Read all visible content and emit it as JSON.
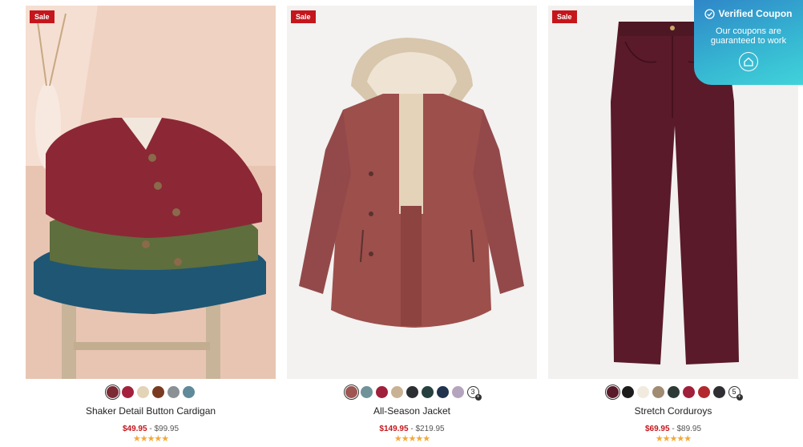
{
  "products": [
    {
      "badge": "Sale",
      "name": "Shaker Detail Button Cardigan",
      "sale_price": "$49.95",
      "separator": "-",
      "original_price": "$99.95",
      "rating_stars": "★★★★★",
      "image_icon": "stacked-cardigans-image",
      "swatches": [
        "#7c2a34",
        "#a3213d",
        "#e3d3b7",
        "#7a3a22",
        "#8a9094",
        "#5e8a9a"
      ],
      "selected_swatch": 0
    },
    {
      "badge": "Sale",
      "name": "All-Season Jacket",
      "sale_price": "$149.95",
      "separator": "-",
      "original_price": "$219.95",
      "rating_stars": "★★★★★",
      "image_icon": "hooded-jacket-image",
      "swatches": [
        "#9e5652",
        "#6f9398",
        "#a01f3b",
        "#c9b294",
        "#2b2e33",
        "#26403f",
        "#21324e",
        "#b5a4bd"
      ],
      "selected_swatch": 0,
      "more_count": "3"
    },
    {
      "badge": "Sale",
      "name": "Stretch Corduroys",
      "sale_price": "$69.95",
      "separator": "-",
      "original_price": "$89.95",
      "rating_stars": "★★★★★",
      "image_icon": "corduroy-pants-image",
      "swatches": [
        "#5a1a2a",
        "#1c1c1c",
        "#f1eadf",
        "#a08b73",
        "#2d3a36",
        "#a01f3b",
        "#b3282f",
        "#2f2f33"
      ],
      "selected_swatch": 0,
      "more_count": "5"
    }
  ],
  "coupon": {
    "title": "Verified Coupon",
    "line1": "Our coupons are",
    "line2": "guaranteed to work",
    "check_icon": "check-circle-icon",
    "home_icon": "home-icon"
  }
}
